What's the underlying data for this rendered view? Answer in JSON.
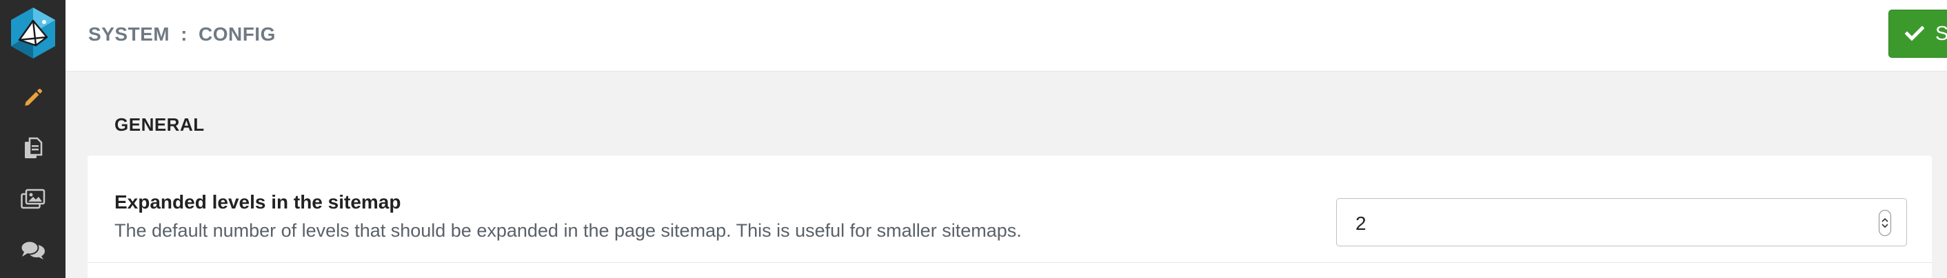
{
  "sidebar": {
    "logo": {
      "icon": "logo-icon"
    },
    "items": [
      {
        "icon": "pencil-icon",
        "color": "#e8a33c"
      },
      {
        "icon": "documents-icon",
        "color": "#c9c9c9"
      },
      {
        "icon": "images-icon",
        "color": "#c9c9c9"
      },
      {
        "icon": "comments-icon",
        "color": "#c9c9c9"
      }
    ]
  },
  "header": {
    "breadcrumb": {
      "part1": "SYSTEM",
      "separator": ":",
      "part2": "CONFIG"
    },
    "save_label": "Save",
    "save_icon": "check-icon",
    "save_color": "#3c9a2d"
  },
  "section": {
    "title": "GENERAL",
    "setting": {
      "label": "Expanded levels in the sitemap",
      "description": "The default number of levels that should be expanded in the page sitemap. This is useful for smaller sitemaps.",
      "value": "2"
    }
  }
}
